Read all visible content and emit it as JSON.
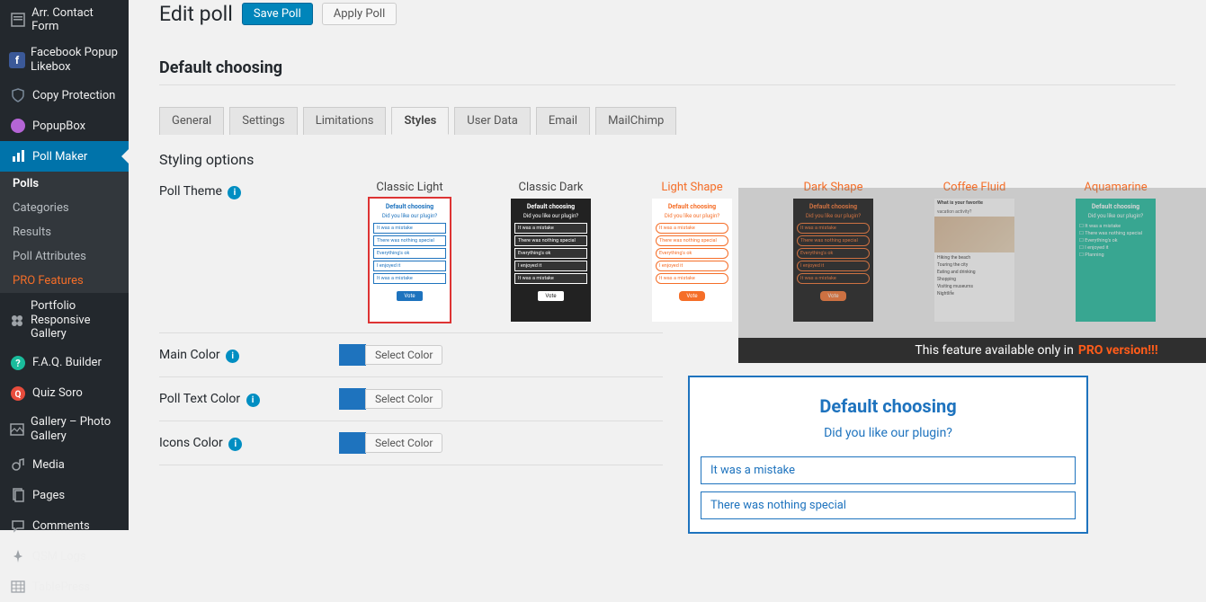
{
  "sidebar": {
    "items": [
      {
        "label": "Arr. Contact Form",
        "icon": "form"
      },
      {
        "label": "Facebook Popup Likebox",
        "icon": "fb"
      },
      {
        "label": "Copy Protection",
        "icon": "shield"
      },
      {
        "label": "PopupBox",
        "icon": "popup"
      },
      {
        "label": "Poll Maker",
        "icon": "poll",
        "active": true
      },
      {
        "label": "Portfolio Responsive Gallery",
        "icon": "portfolio"
      },
      {
        "label": "F.A.Q. Builder",
        "icon": "faq"
      },
      {
        "label": "Quiz Soro",
        "icon": "quiz"
      },
      {
        "label": "Gallery – Photo Gallery",
        "icon": "gallery"
      },
      {
        "label": "Media",
        "icon": "media"
      },
      {
        "label": "Pages",
        "icon": "pages"
      },
      {
        "label": "Comments",
        "icon": "comments"
      },
      {
        "label": "QSM Logs",
        "icon": "logs"
      },
      {
        "label": "TablePress",
        "icon": "table"
      }
    ],
    "sub": [
      {
        "label": "Polls",
        "current": true
      },
      {
        "label": "Categories"
      },
      {
        "label": "Results"
      },
      {
        "label": "Poll Attributes"
      },
      {
        "label": "PRO Features",
        "pro": true
      }
    ]
  },
  "header": {
    "title": "Edit poll",
    "save": "Save Poll",
    "apply": "Apply Poll"
  },
  "section": "Default choosing",
  "tabs": [
    "General",
    "Settings",
    "Limitations",
    "Styles",
    "User Data",
    "Email",
    "MailChimp"
  ],
  "active_tab": "Styles",
  "styling_title": "Styling options",
  "theme_label": "Poll Theme",
  "themes": [
    {
      "name": "Classic Light",
      "kind": "cl",
      "selected": true
    },
    {
      "name": "Classic Dark",
      "kind": "cd"
    },
    {
      "name": "Light Shape",
      "kind": "ls",
      "pro": true
    },
    {
      "name": "Dark Shape",
      "kind": "ds",
      "pro": true
    },
    {
      "name": "Coffee Fluid",
      "kind": "cf",
      "pro": true
    },
    {
      "name": "Aquamarine",
      "kind": "aq",
      "pro": true
    }
  ],
  "mini_poll": {
    "title": "Default choosing",
    "question": "Did you like our plugin?",
    "opts": [
      "It was a mistake",
      "There was nothing special",
      "Everything's ok",
      "I enjoyed it",
      "It was a mistake"
    ],
    "vote": "Vote"
  },
  "coffee": {
    "h1": "What is your favorite",
    "h2": "vacation activity?",
    "list": [
      "Hiking the beach",
      "Touring the city",
      "Eating and drinking",
      "Shopping",
      "Visiting museums",
      "Nightlife"
    ]
  },
  "aqua_opts": [
    "It was a mistake",
    "There was nothing special",
    "Everything's ok",
    "I enjoyed it",
    "Planning"
  ],
  "pro_banner": {
    "text": "This feature available only in ",
    "link": "PRO version!!!"
  },
  "colors": [
    {
      "label": "Main Color",
      "swatch": "#1e73be"
    },
    {
      "label": "Poll Text Color",
      "swatch": "#1e73be"
    },
    {
      "label": "Icons Color",
      "swatch": "#1e73be"
    }
  ],
  "select_color_label": "Select Color",
  "preview": {
    "title": "Default choosing",
    "question": "Did you like our plugin?",
    "opts": [
      "It was a mistake",
      "There was nothing special"
    ]
  }
}
